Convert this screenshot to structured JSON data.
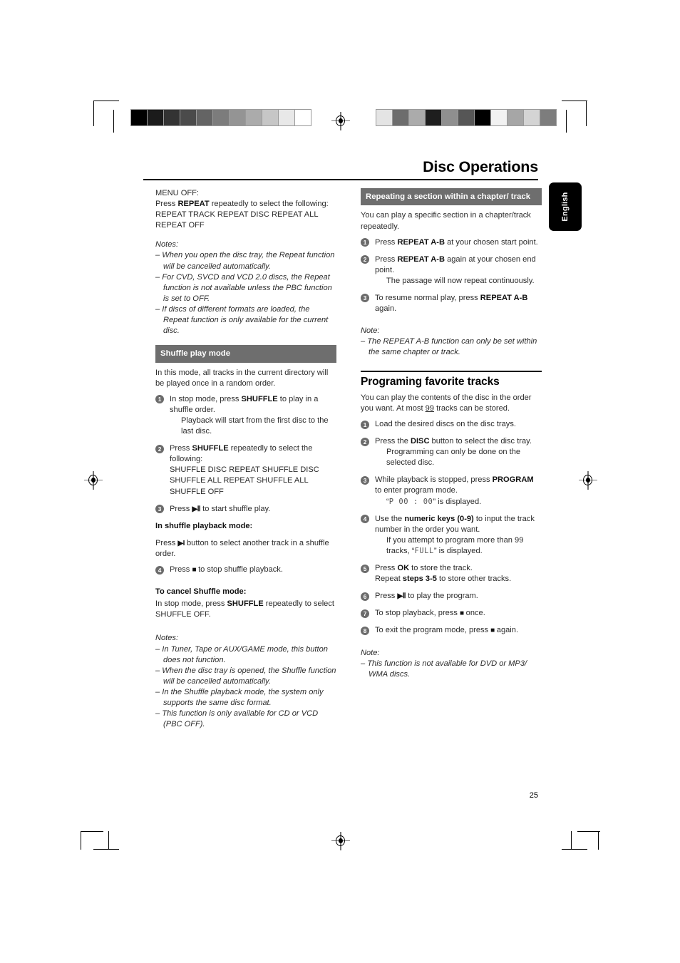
{
  "page": {
    "title": "Disc Operations",
    "language_tab": "English",
    "page_number": "25"
  },
  "marks": {
    "gray_strip_left": [
      "#000000",
      "#1b1b1b",
      "#333333",
      "#4b4b4b",
      "#646464",
      "#7c7c7c",
      "#949494",
      "#ababab",
      "#c6c6c6",
      "#e8e8e8",
      "#ffffff"
    ],
    "gray_strip_right": [
      "#e4e4e4",
      "#6d6d6d",
      "#ababab",
      "#1e1e1e",
      "#8f8f8f",
      "#565656",
      "#000000",
      "#f2f2f2",
      "#a6a6a6",
      "#d4d4d4",
      "#7d7d7d"
    ],
    "registration_icon": "registration-target-icon"
  },
  "left_column": {
    "menu_off": {
      "label": "MENU OFF:",
      "line1_pre": "Press ",
      "line1_bold": "REPEAT",
      "line1_post": " repeatedly to select the following:",
      "options": "REPEAT TRACK     REPEAT DISC     REPEAT ALL     REPEAT OFF"
    },
    "repeat_notes": {
      "label": "Notes:",
      "items": [
        "–  When you open the disc tray, the Repeat function will be cancelled automatically.",
        "–  For CVD, SVCD and VCD 2.0 discs, the Repeat function is not available unless the PBC function is set to OFF.",
        "–  If discs of different formats are loaded, the Repeat function is only available for the current disc."
      ]
    },
    "shuffle": {
      "band": "Shuffle play mode",
      "intro": "In this mode, all tracks in the current directory will be played once in a random order.",
      "steps": [
        {
          "num": "1",
          "pre": "In stop mode, press ",
          "bold": "SHUFFLE",
          "post": " to play in a shuffle order.",
          "indent": "Playback will start from the first disc to the last disc."
        },
        {
          "num": "2",
          "pre": "Press ",
          "bold": "SHUFFLE",
          "post": " repeatedly to select the following:",
          "options_line1": "SHUFFLE DISC     REPEAT SHUFFLE DISC",
          "options_line2": "SHUFFLE ALL     REPEAT SHUFFLE ALL",
          "options_line3": "SHUFFLE OFF"
        },
        {
          "num": "3",
          "pre": "Press ",
          "glyph": "▶Ⅱ",
          "post": " to start shuffle play."
        },
        {
          "num": "4",
          "pre": "Press ",
          "glyph": "■",
          "post": " to stop shuffle playback."
        }
      ],
      "playback_subhead": "In shuffle playback mode:",
      "playback_pre": "Press ",
      "playback_glyph": "▶I",
      "playback_post": " button to select another track in a shuffle order.",
      "cancel_subhead": "To cancel Shuffle mode:",
      "cancel_pre": "In stop mode, press ",
      "cancel_bold": "SHUFFLE",
      "cancel_post": " repeatedly to select SHUFFLE OFF."
    },
    "shuffle_notes": {
      "label": "Notes:",
      "items": [
        "–  In Tuner, Tape or AUX/GAME mode, this button does not function.",
        "–  When the disc tray is opened, the Shuffle function will be cancelled automatically.",
        "–  In the Shuffle playback mode, the system only supports the same disc format.",
        "–  This function is only available for CD or VCD (PBC OFF)."
      ]
    }
  },
  "right_column": {
    "repeat_ab": {
      "band": "Repeating a section within a chapter/ track",
      "intro": "You can play a specific section in a chapter/track repeatedly.",
      "steps": [
        {
          "num": "1",
          "pre": "Press ",
          "bold": "REPEAT A-B",
          "post": " at your chosen start point."
        },
        {
          "num": "2",
          "pre": "Press ",
          "bold": "REPEAT A-B",
          "post": " again at your chosen end point.",
          "indent": "The passage will now repeat continuously."
        },
        {
          "num": "3",
          "pre": "To resume normal play, press ",
          "bold": "REPEAT A-B",
          "post": " again."
        }
      ],
      "note_label": "Note:",
      "note_body": "–  The REPEAT A-B function can only be set within the same chapter or track."
    },
    "program": {
      "heading": "Programing favorite tracks",
      "intro_pre": "You can play the contents of the disc in the order you want. At most ",
      "intro_underline": "99",
      "intro_post": " tracks can be stored.",
      "steps": [
        {
          "num": "1",
          "pre": "Load the desired discs on the disc trays."
        },
        {
          "num": "2",
          "pre": "Press the ",
          "bold": "DISC",
          "post": " button to select the disc tray.",
          "indent": "Programming can only be done on the selected disc."
        },
        {
          "num": "3",
          "pre": "While playback is stopped, press ",
          "bold": "PROGRAM",
          "post": " to enter program mode.",
          "indent_pre": "“",
          "indent_lcd": "P  00 : 00",
          "indent_post": "” is displayed."
        },
        {
          "num": "4",
          "pre": "Use the ",
          "bold": "numeric keys (0-9)",
          "post": " to input the track number in the order you want.",
          "indent_pre": "If you attempt to program more than 99 tracks, “",
          "indent_lcd": "FULL",
          "indent_post": "” is displayed."
        },
        {
          "num": "5",
          "pre": "Press ",
          "bold": "OK",
          "post": " to store the track.",
          "repeat_pre": "Repeat ",
          "repeat_bold": "steps 3-5",
          "repeat_post": " to store other tracks."
        },
        {
          "num": "6",
          "pre": "Press ",
          "glyph": "▶Ⅱ",
          "post": " to play the program."
        },
        {
          "num": "7",
          "pre": "To stop playback, press ",
          "glyph": "■",
          "post": " once."
        },
        {
          "num": "8",
          "pre": "To exit the program mode, press ",
          "glyph": "■",
          "post": " again."
        }
      ],
      "note_label": "Note:",
      "note_body": "–  This function is not available for DVD or MP3/ WMA discs."
    }
  }
}
